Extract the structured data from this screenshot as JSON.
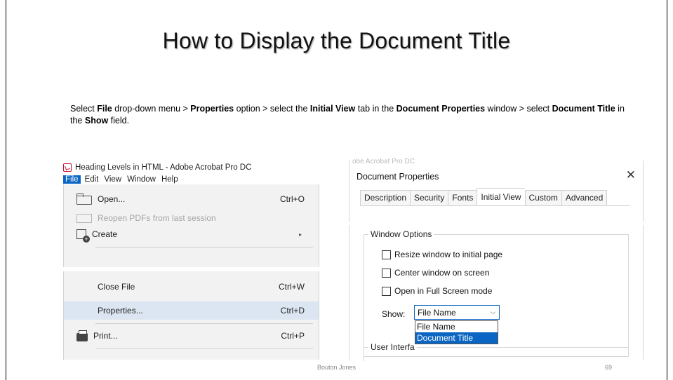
{
  "slide": {
    "title": "How to Display the Document Title",
    "instruction": {
      "p1": "Select ",
      "b1": "File",
      "p2": " drop-down menu > ",
      "b2": "Properties",
      "p3": " option > select the ",
      "b3": "Initial View",
      "p4": " tab in the ",
      "b4": "Document Properties",
      "p5": " window > select ",
      "b5": "Document Title",
      "p6": " in the ",
      "b6": "Show",
      "p7": " field."
    },
    "footer_author": "Bouton Jones",
    "page_number": "69"
  },
  "acrobat": {
    "window_title": "Heading Levels in HTML - Adobe Acrobat Pro DC",
    "menubar": [
      "File",
      "Edit",
      "View",
      "Window",
      "Help"
    ],
    "file_menu": {
      "open": {
        "label": "Open...",
        "shortcut": "Ctrl+O"
      },
      "reopen": {
        "label": "Reopen PDFs from last session"
      },
      "create": {
        "label": "Create"
      },
      "close": {
        "label": "Close File",
        "shortcut": "Ctrl+W"
      },
      "properties": {
        "label": "Properties...",
        "shortcut": "Ctrl+D"
      },
      "print": {
        "label": "Print...",
        "shortcut": "Ctrl+P"
      }
    },
    "icons": [
      "folder-icon",
      "reopen-icon",
      "create-icon",
      "printer-icon",
      "pdf-icon"
    ]
  },
  "document_properties": {
    "ghost_title": "obe Acrobat Pro DC",
    "title": "Document Properties",
    "close_glyph": "✕",
    "tabs": [
      "Description",
      "Security",
      "Fonts",
      "Initial View",
      "Custom",
      "Advanced"
    ],
    "active_tab": "Initial View",
    "window_options": {
      "legend": "Window Options",
      "checks": [
        {
          "label": "Resize window to initial page",
          "checked": false
        },
        {
          "label": "Center window on screen",
          "checked": false
        },
        {
          "label": "Open in Full Screen mode",
          "checked": false
        }
      ],
      "show_label": "Show:",
      "show_value": "File Name",
      "options": [
        "File Name",
        "Document Title"
      ],
      "highlighted_option": "Document Title"
    },
    "user_interface_legend": "User Interfa"
  },
  "colors": {
    "accent": "#0a66c2",
    "menu_highlight": "#dce6f2",
    "pdf_red": "#c8102e"
  }
}
